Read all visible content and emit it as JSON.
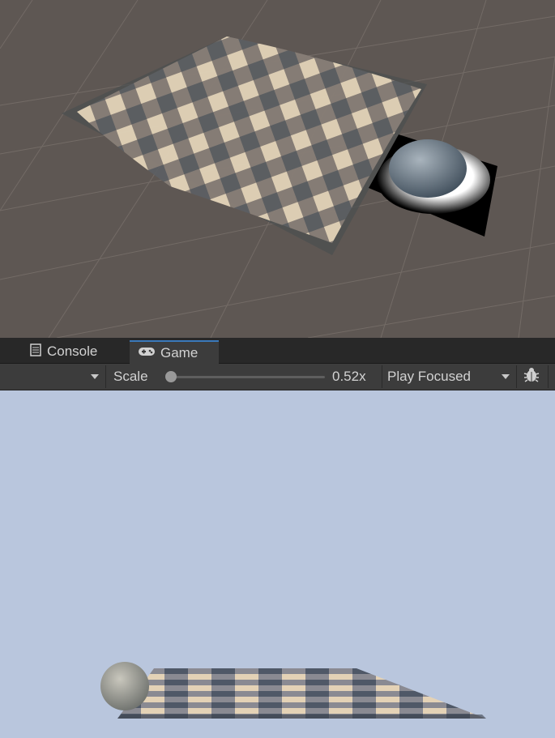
{
  "tabs": [
    {
      "label": "Console",
      "icon": "console-icon"
    },
    {
      "label": "Game",
      "icon": "gamepad-icon"
    }
  ],
  "toolbar": {
    "scale_label": "Scale",
    "scale_value": "0.52x",
    "scale_fraction": 0.02,
    "play_mode": "Play Focused",
    "debug_icon": "bug-icon"
  },
  "colors": {
    "scene_bg": "#5e5753",
    "game_bg": "#b9c6dd",
    "cloth_light": "#e8d6b8",
    "cloth_dark": "#5f6670",
    "rock": "#6f7f8f"
  }
}
